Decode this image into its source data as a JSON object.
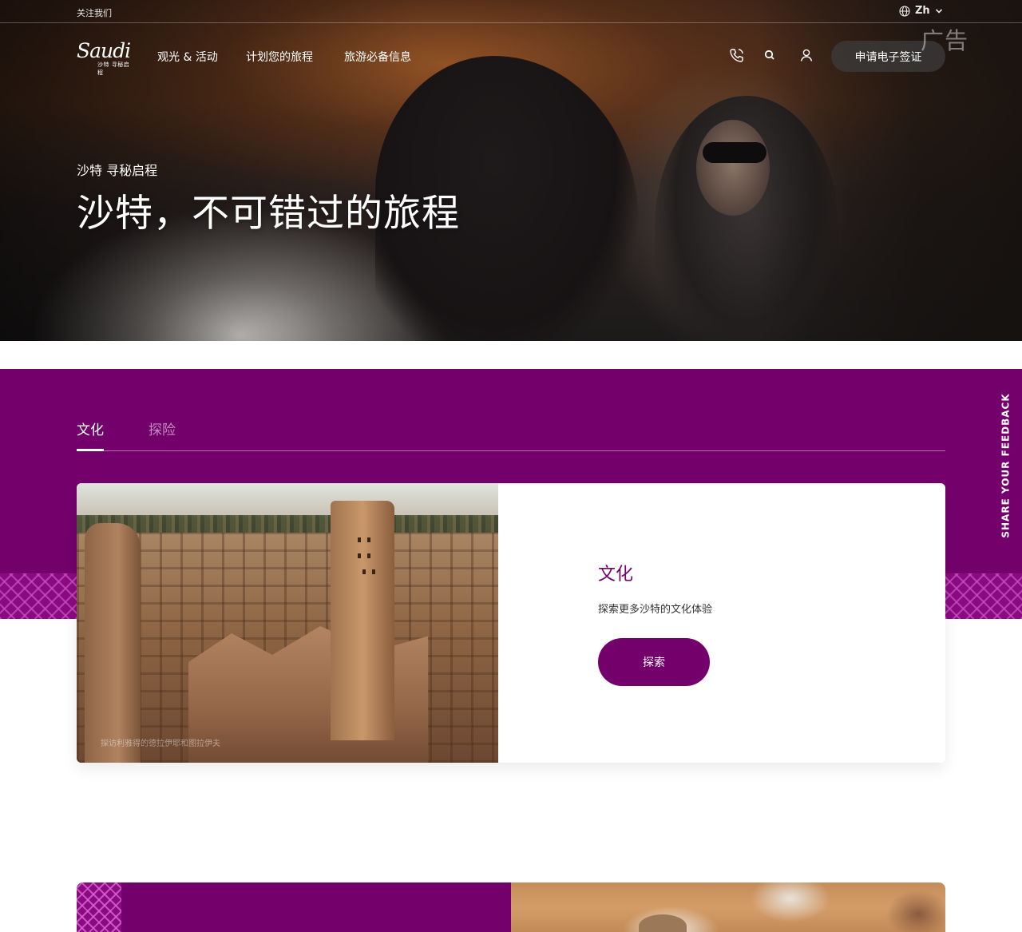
{
  "utility_bar": {
    "follow_us": "关注我们",
    "language": "Zh"
  },
  "header": {
    "logo_text": "Saudi",
    "logo_subtext": "沙特 寻秘启程",
    "nav": [
      {
        "label": "观光 & 活动"
      },
      {
        "label": "计划您的旅程"
      },
      {
        "label": "旅游必备信息"
      }
    ],
    "evisa_label": "申请电子签证",
    "ad_label": "广告"
  },
  "hero": {
    "eyebrow": "沙特 寻秘启程",
    "title": "沙特，不可错过的旅程"
  },
  "tabs": [
    {
      "label": "文化",
      "active": true
    },
    {
      "label": "探险",
      "active": false
    }
  ],
  "card": {
    "image_caption": "探访利雅得的德拉伊耶和图拉伊夫",
    "title": "文化",
    "description": "探索更多沙特的文化体验",
    "button_label": "探索"
  },
  "feedback": {
    "label": "SHARE YOUR FEEDBACK"
  },
  "colors": {
    "brand_purple": "#74006c",
    "pattern_purple": "#8a0a82",
    "white": "#ffffff"
  },
  "icons": [
    "globe-icon",
    "chevron-down-icon",
    "phone-icon",
    "search-icon",
    "user-icon"
  ]
}
